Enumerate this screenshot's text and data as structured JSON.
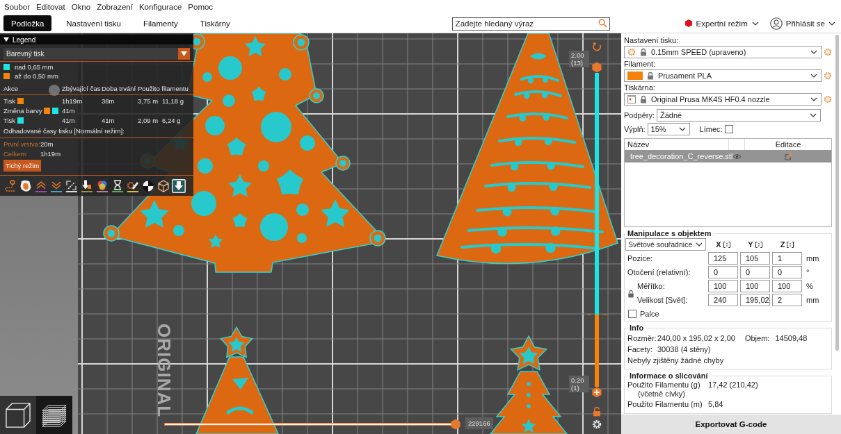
{
  "menu": [
    "Soubor",
    "Editovat",
    "Okno",
    "Zobrazení",
    "Konfigurace",
    "Pomoc"
  ],
  "tabs": [
    {
      "label": "Podložka",
      "selected": true
    },
    {
      "label": "Nastavení tisku",
      "selected": false
    },
    {
      "label": "Filamenty",
      "selected": false
    },
    {
      "label": "Tiskárny",
      "selected": false
    }
  ],
  "search": {
    "placeholder": "Zadejte hledaný výraz"
  },
  "mode": {
    "label": "Expertní režim"
  },
  "account": {
    "label": "Přihlásit se"
  },
  "legend": {
    "title": "Legend",
    "expanded": true,
    "view_type": "Barevný tisk",
    "items": [
      {
        "label": "nad 0,65 mm",
        "color": "#1ee3e3"
      },
      {
        "label": "až do 0,50 mm",
        "color": "#f5820d"
      }
    ],
    "columns": [
      "Akce",
      "Zbývající čas",
      "Doba trvání",
      "Použito filamentu"
    ],
    "rows": [
      {
        "action": "Tisk",
        "swatches": [
          {
            "color": "#f5820d"
          }
        ],
        "remaining": "1h19m",
        "duration": "38m",
        "length": "3,75 m",
        "weight": "11,18 g"
      },
      {
        "action": "Změna barvy",
        "swatches": [
          {
            "color": "#f5820d"
          },
          {
            "color": "#1ee3e3"
          }
        ],
        "remaining": "41m"
      },
      {
        "action": "Tisk",
        "swatches": [
          {
            "color": "#1ee3e3"
          }
        ],
        "remaining": "41m",
        "duration": "41m",
        "length": "2,09 m",
        "weight": "6,24 g"
      }
    ],
    "estimate_title": "Odhadované časy tisku [Normální režim]:",
    "estimates": [
      {
        "label": "První vrstva:",
        "value": "20m"
      },
      {
        "label": "Celkem:",
        "value": "1h19m"
      }
    ],
    "mode_button": "Tichý režim",
    "toolbar": [
      {
        "kind": "travel",
        "on": false
      },
      {
        "kind": "wipe",
        "on": false
      },
      {
        "kind": "retractions",
        "on": false
      },
      {
        "kind": "deretractions",
        "on": false
      },
      {
        "kind": "seams",
        "on": false
      },
      {
        "kind": "tool_changes",
        "on": false
      },
      {
        "kind": "color_changes",
        "on": false
      },
      {
        "kind": "pauses",
        "on": false
      },
      {
        "kind": "custom_gcodes",
        "on": false
      },
      {
        "kind": "center_of_gravity",
        "on": false
      },
      {
        "kind": "shells",
        "on": false
      },
      {
        "kind": "tool_marker",
        "on": true
      }
    ]
  },
  "viewport": {
    "bed_label": "ORIGINAL",
    "view_buttons": [
      {
        "kind": "editor",
        "selected": false
      },
      {
        "kind": "preview",
        "selected": true
      }
    ],
    "move_slider": {
      "level": 1,
      "label": "229166"
    },
    "layer_slider": {
      "level": 0.23,
      "colors": [
        {
          "color": "#1ee3e3"
        },
        {
          "color": "#f5820d"
        }
      ],
      "thumbs": [
        {
          "value": "2.00",
          "layer": "(13)",
          "level": 1,
          "selected": false
        },
        {
          "value": "0.20",
          "layer": "(1)",
          "level": 0,
          "selected": true
        }
      ]
    }
  },
  "print_settings": {
    "label": "Nastavení tisku:",
    "value": "0.15mm SPEED (upraveno)"
  },
  "filament": {
    "label": "Filament:",
    "value": "Prusament PLA",
    "color": "#f5820d"
  },
  "printer": {
    "label": "Tiskárna:",
    "value": "Original Prusa MK4S HF0.4 nozzle"
  },
  "supports": {
    "label": "Podpěry:",
    "value": "Žádné"
  },
  "infill": {
    "label": "Výplň:",
    "value": "15%"
  },
  "brim": {
    "label": "Límec:",
    "checked": false
  },
  "object_list": {
    "columns": [
      "Název",
      "Editace"
    ],
    "rows": [
      {
        "name": "tree_decoration_C_reverse.stl",
        "selected": true
      }
    ]
  },
  "manipulation": {
    "title": "Manipulace s objektem",
    "coordinates": "Světové souřadnice",
    "axes": [
      "X",
      "Y",
      "Z"
    ],
    "rows": [
      {
        "kind": "position",
        "label": "Pozice:",
        "values": [
          "125",
          "105",
          "1"
        ],
        "unit": "mm"
      },
      {
        "kind": "rotation",
        "label": "Otočení (relativní):",
        "values": [
          "0",
          "0",
          "0"
        ],
        "unit": "°"
      },
      {
        "kind": "scale",
        "label": "Měřítko:",
        "values": [
          "100",
          "100",
          "100"
        ],
        "unit": "%"
      },
      {
        "kind": "size",
        "label": "Velikost [Svět]:",
        "values": [
          "240",
          "195,02",
          "2"
        ],
        "unit": "mm"
      }
    ],
    "inches": {
      "label": "Palce",
      "checked": false
    }
  },
  "info": {
    "title": "Info",
    "size_label": "Rozměr:",
    "size": "240,00 x 195,02 x 2,00",
    "volume_label": "Objem:",
    "volume": "14509,48",
    "facets_label": "Facety:",
    "facets": "30038 (4 stěny)",
    "status": "Nebyly zjištěny žádné chyby"
  },
  "slicing_info": {
    "title": "Informace o slicování",
    "rows": [
      {
        "label": "Použito Filamentu (g)",
        "note": "(včetně cívky)",
        "value": "17,42 (210,42)"
      },
      {
        "label": "Použito Filamentu (m)",
        "value": "5,84"
      }
    ]
  },
  "export_button": "Exportovat G-code"
}
